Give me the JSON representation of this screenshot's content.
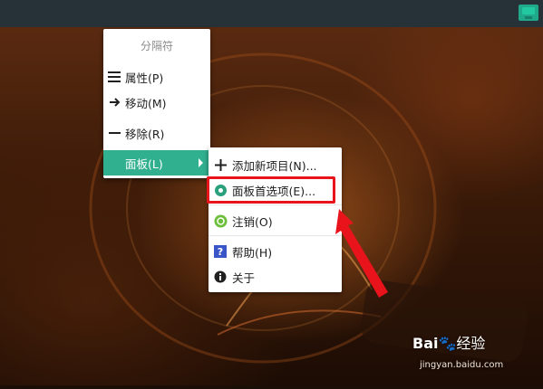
{
  "menu1": {
    "title": "分隔符",
    "items": [
      {
        "label": "属性(P)",
        "icon": "list-icon"
      },
      {
        "label": "移动(M)",
        "icon": "arrow-right-icon"
      },
      {
        "label": "移除(R)",
        "icon": "minus-icon"
      },
      {
        "label": "面板(L)",
        "active": true
      }
    ]
  },
  "menu2": {
    "items": [
      {
        "label": "添加新项目(N)...",
        "icon": "plus-icon"
      },
      {
        "label": "面板首选项(E)...",
        "icon": "preferences-icon"
      },
      {
        "label": "注销(O)",
        "icon": "logout-icon"
      },
      {
        "label": "帮助(H)",
        "icon": "help-icon"
      },
      {
        "label": "关于",
        "icon": "info-icon"
      }
    ]
  },
  "colors": {
    "panel": "#263238",
    "active": "#30b08f",
    "highlight": "#e8131b"
  },
  "watermark": {
    "brand": "Bai",
    "suffix": "经验",
    "url": "jingyan.baidu.com"
  }
}
